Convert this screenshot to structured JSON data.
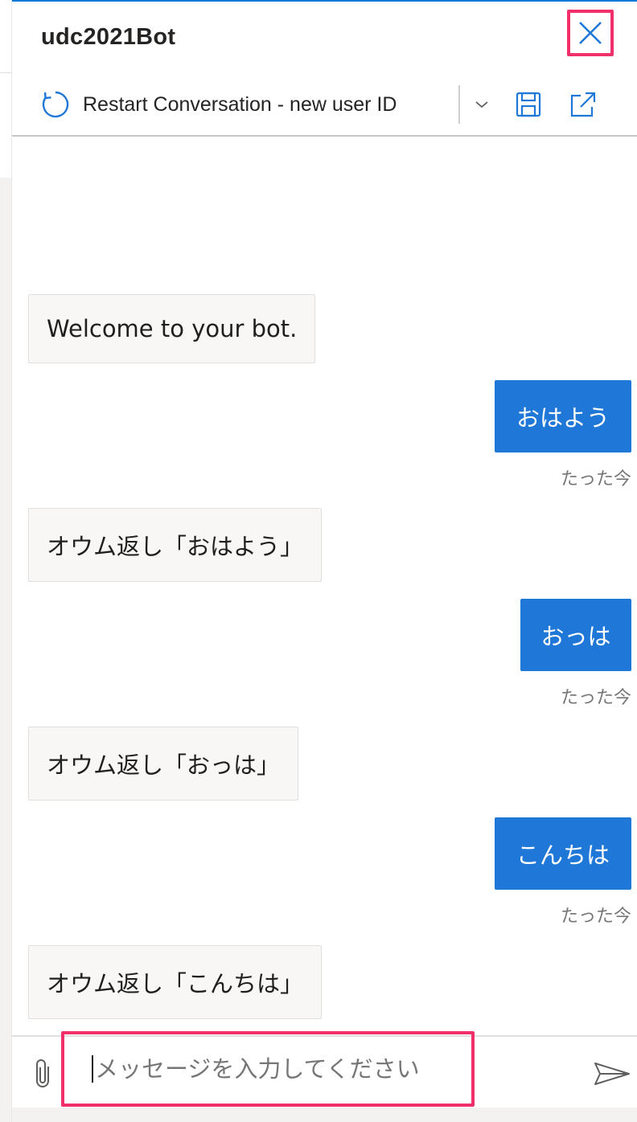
{
  "header": {
    "title": "udc2021Bot",
    "close_icon": "close-icon",
    "close_highlight_color": "#f0306a"
  },
  "toolbar": {
    "restart_icon": "refresh-icon",
    "restart_label": "Restart Conversation - new user ID",
    "dropdown_icon": "chevron-down-icon",
    "save_icon": "save-icon",
    "popout_icon": "popout-icon",
    "accent_color": "#0078d4"
  },
  "messages": [
    {
      "from": "bot",
      "text": "Welcome to your bot."
    },
    {
      "from": "user",
      "text": "おはよう",
      "time": "たった今"
    },
    {
      "from": "bot",
      "text": "オウム返し「おはよう」"
    },
    {
      "from": "user",
      "text": "おっは",
      "time": "たった今"
    },
    {
      "from": "bot",
      "text": "オウム返し「おっは」"
    },
    {
      "from": "user",
      "text": "こんちは",
      "time": "たった今"
    },
    {
      "from": "bot",
      "text": "オウム返し「こんちは」"
    }
  ],
  "input": {
    "placeholder": "メッセージを入力してください",
    "value": "",
    "attach_icon": "paperclip-icon",
    "send_icon": "send-icon",
    "highlight_color": "#f0306a"
  },
  "colors": {
    "user_bubble": "#1f77d8",
    "bot_bubble": "#f8f7f6"
  }
}
